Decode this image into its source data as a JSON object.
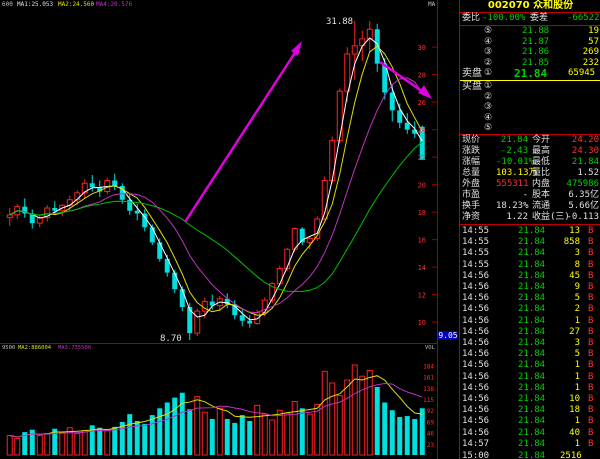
{
  "chart": {
    "top_label": "600",
    "ma_labels": {
      "ma1": "MA1:25.053",
      "ma2": "MA2:24.560",
      "ma4": "MA4:20.576"
    },
    "corner_label": "MA",
    "price_axis": [
      "30",
      "28",
      "26",
      "24",
      "22",
      "20",
      "18",
      "16",
      "14",
      "12",
      "10"
    ],
    "high_annotation": "31.88",
    "low_annotation": "8.70",
    "current_price_tag": "9.05",
    "vol_labels": {
      "base": "9500",
      "ma2": "MA2:886004",
      "ma3": "MA3:735500"
    },
    "vol_corner": "VOL",
    "vol_axis": [
      "184",
      "161",
      "138",
      "115",
      "92",
      "69",
      "46",
      "23"
    ],
    "colors": {
      "up": "#ff2020",
      "down": "#00e0e0",
      "ma_white": "#ffffff",
      "ma_yellow": "#e0e000",
      "ma_purple": "#c030c0",
      "ma_green": "#00c000",
      "arrow": "#e000e0"
    },
    "candles": [
      [
        17.6,
        18.3,
        17.0,
        17.8
      ],
      [
        17.8,
        18.6,
        17.5,
        18.4
      ],
      [
        18.4,
        19.0,
        17.6,
        17.9
      ],
      [
        17.9,
        18.2,
        16.8,
        17.2
      ],
      [
        17.2,
        17.8,
        16.9,
        17.6
      ],
      [
        17.6,
        18.5,
        17.3,
        18.3
      ],
      [
        18.3,
        18.8,
        17.9,
        18.1
      ],
      [
        18.1,
        18.6,
        17.7,
        18.5
      ],
      [
        18.5,
        19.2,
        18.1,
        18.9
      ],
      [
        18.9,
        19.6,
        18.5,
        19.4
      ],
      [
        19.4,
        20.4,
        19.0,
        20.1
      ],
      [
        20.1,
        20.7,
        19.5,
        19.8
      ],
      [
        19.8,
        20.3,
        19.1,
        19.5
      ],
      [
        19.5,
        20.5,
        19.3,
        20.3
      ],
      [
        20.3,
        20.8,
        19.6,
        19.9
      ],
      [
        19.9,
        20.1,
        18.6,
        18.9
      ],
      [
        18.9,
        19.3,
        17.8,
        18.1
      ],
      [
        18.1,
        18.6,
        17.4,
        17.9
      ],
      [
        17.9,
        18.2,
        16.6,
        16.9
      ],
      [
        16.9,
        17.1,
        15.6,
        15.8
      ],
      [
        15.8,
        16.1,
        14.4,
        14.6
      ],
      [
        14.6,
        14.9,
        13.3,
        13.6
      ],
      [
        13.6,
        13.8,
        12.1,
        12.4
      ],
      [
        12.4,
        12.6,
        10.8,
        11.1
      ],
      [
        11.1,
        11.4,
        8.7,
        9.2
      ],
      [
        9.2,
        11.0,
        9.0,
        10.8
      ],
      [
        10.8,
        11.8,
        10.3,
        11.5
      ],
      [
        11.5,
        12.0,
        10.9,
        11.2
      ],
      [
        11.2,
        11.9,
        10.8,
        11.7
      ],
      [
        11.7,
        12.1,
        11.0,
        11.3
      ],
      [
        11.3,
        11.6,
        10.2,
        10.5
      ],
      [
        10.5,
        10.9,
        9.7,
        10.1
      ],
      [
        10.1,
        10.5,
        9.6,
        9.9
      ],
      [
        9.9,
        10.9,
        9.8,
        10.7
      ],
      [
        10.7,
        11.8,
        10.4,
        11.6
      ],
      [
        11.6,
        12.9,
        11.4,
        12.8
      ],
      [
        12.8,
        14.1,
        12.6,
        13.9
      ],
      [
        13.9,
        15.4,
        13.7,
        15.3
      ],
      [
        15.3,
        16.9,
        15.1,
        16.8
      ],
      [
        16.8,
        16.9,
        15.6,
        15.8
      ],
      [
        15.8,
        16.3,
        15.3,
        16.1
      ],
      [
        16.1,
        17.7,
        15.9,
        17.5
      ],
      [
        17.5,
        20.6,
        17.4,
        20.3
      ],
      [
        20.3,
        23.5,
        20.1,
        23.2
      ],
      [
        23.2,
        27.0,
        23.0,
        26.8
      ],
      [
        26.8,
        30.0,
        26.0,
        29.5
      ],
      [
        29.5,
        31.9,
        27.6,
        30.1
      ],
      [
        30.1,
        31.2,
        29.0,
        30.6
      ],
      [
        30.6,
        31.9,
        29.6,
        31.3
      ],
      [
        31.3,
        31.7,
        28.2,
        28.8
      ],
      [
        28.8,
        29.2,
        26.2,
        26.7
      ],
      [
        26.7,
        27.3,
        24.6,
        25.4
      ],
      [
        25.4,
        25.9,
        24.1,
        24.5
      ],
      [
        24.5,
        25.2,
        23.7,
        24.0
      ],
      [
        24.0,
        24.6,
        23.4,
        23.7
      ],
      [
        24.2,
        24.3,
        21.8,
        21.8
      ]
    ],
    "volumes": [
      40,
      34,
      47,
      52,
      40,
      44,
      54,
      46,
      56,
      44,
      50,
      61,
      56,
      50,
      58,
      68,
      84,
      70,
      64,
      82,
      96,
      108,
      118,
      128,
      94,
      120,
      88,
      74,
      96,
      74,
      66,
      82,
      70,
      102,
      84,
      72,
      92,
      86,
      110,
      96,
      84,
      104,
      172,
      148,
      122,
      154,
      185,
      162,
      174,
      140,
      108,
      92,
      78,
      80,
      74,
      96
    ]
  },
  "panel": {
    "title": "002070 众和股份",
    "ratio_label": "委比",
    "ratio_value": "-100.00%",
    "diff_label": "委差",
    "diff_value": "-66522",
    "sells": [
      {
        "idx": "⑤",
        "price": "21.88",
        "vol": "19"
      },
      {
        "idx": "④",
        "price": "21.87",
        "vol": "57"
      },
      {
        "idx": "③",
        "price": "21.86",
        "vol": "269"
      },
      {
        "idx": "②",
        "price": "21.85",
        "vol": "232"
      }
    ],
    "sell1": {
      "label": "卖盘",
      "idx": "①",
      "price": "21.84",
      "vol": "65945"
    },
    "buy_label": "买盘",
    "buys": [
      "①",
      "②",
      "③",
      "④",
      "⑤"
    ],
    "stats": [
      {
        "l1": "现价",
        "v1": "21.84",
        "l2": "今开",
        "v2": "24.20",
        "c1": "grn",
        "c2": "red"
      },
      {
        "l1": "涨跌",
        "v1": "-2.43",
        "l2": "最高",
        "v2": "24.30",
        "c1": "grn",
        "c2": "red"
      },
      {
        "l1": "涨幅",
        "v1": "-10.01%",
        "l2": "最低",
        "v2": "21.84",
        "c1": "grn",
        "c2": "grn"
      },
      {
        "l1": "总量",
        "v1": "103.13万",
        "l2": "量比",
        "v2": "1.52",
        "c1": "yel",
        "c2": "wht"
      },
      {
        "l1": "外盘",
        "v1": "555311",
        "l2": "内盘",
        "v2": "475986",
        "c1": "red",
        "c2": "grn"
      },
      {
        "l1": "市盈",
        "v1": "-",
        "l2": "股本",
        "v2": "6.35亿",
        "c1": "wht",
        "c2": "wht"
      },
      {
        "l1": "换手",
        "v1": "18.23%",
        "l2": "流通",
        "v2": "5.66亿",
        "c1": "wht",
        "c2": "wht"
      },
      {
        "l1": "净资",
        "v1": "1.22",
        "l2": "收益(三)",
        "v2": "-0.113",
        "c1": "wht",
        "c2": "wht"
      }
    ],
    "ticks": [
      {
        "t": "14:55",
        "p": "21.84",
        "v": "13",
        "d": "B"
      },
      {
        "t": "14:55",
        "p": "21.84",
        "v": "858",
        "d": "B"
      },
      {
        "t": "14:55",
        "p": "21.84",
        "v": "3",
        "d": "B"
      },
      {
        "t": "14:55",
        "p": "21.84",
        "v": "8",
        "d": "B"
      },
      {
        "t": "14:56",
        "p": "21.84",
        "v": "45",
        "d": "B"
      },
      {
        "t": "14:56",
        "p": "21.84",
        "v": "9",
        "d": "B"
      },
      {
        "t": "14:56",
        "p": "21.84",
        "v": "5",
        "d": "B"
      },
      {
        "t": "14:56",
        "p": "21.84",
        "v": "2",
        "d": "B"
      },
      {
        "t": "14:56",
        "p": "21.84",
        "v": "1",
        "d": "B"
      },
      {
        "t": "14:56",
        "p": "21.84",
        "v": "27",
        "d": "B"
      },
      {
        "t": "14:56",
        "p": "21.84",
        "v": "3",
        "d": "B"
      },
      {
        "t": "14:56",
        "p": "21.84",
        "v": "5",
        "d": "B"
      },
      {
        "t": "14:56",
        "p": "21.84",
        "v": "1",
        "d": "B"
      },
      {
        "t": "14:56",
        "p": "21.84",
        "v": "1",
        "d": "B"
      },
      {
        "t": "14:56",
        "p": "21.84",
        "v": "1",
        "d": "B"
      },
      {
        "t": "14:56",
        "p": "21.84",
        "v": "10",
        "d": "B"
      },
      {
        "t": "14:56",
        "p": "21.84",
        "v": "18",
        "d": "B"
      },
      {
        "t": "14:56",
        "p": "21.84",
        "v": "1",
        "d": "B"
      },
      {
        "t": "14:56",
        "p": "21.84",
        "v": "40",
        "d": "B"
      },
      {
        "t": "14:57",
        "p": "21.84",
        "v": "1",
        "d": "B"
      }
    ],
    "bottom": {
      "t": "15:00",
      "p": "21.84",
      "v": "2516",
      "d": ""
    }
  }
}
